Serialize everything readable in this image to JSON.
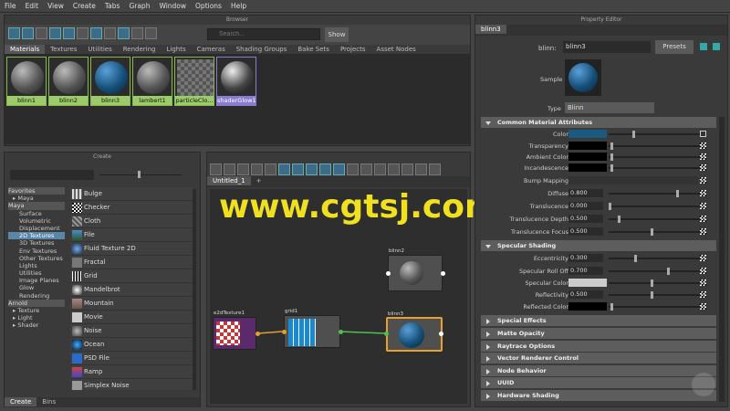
{
  "menu": [
    "File",
    "Edit",
    "View",
    "Create",
    "Tabs",
    "Graph",
    "Window",
    "Options",
    "Help"
  ],
  "browser": {
    "title": "Browser",
    "search_placeholder": "Search...",
    "show_label": "Show",
    "tabs": [
      "Materials",
      "Textures",
      "Utilities",
      "Rendering",
      "Lights",
      "Cameras",
      "Shading Groups",
      "Bake Sets",
      "Projects",
      "Asset Nodes"
    ],
    "swatches": [
      "blinn1",
      "blinn2",
      "blinn3",
      "lambert1",
      "particleClo...",
      "shaderGlow1"
    ]
  },
  "create": {
    "title": "Create",
    "tree": [
      "Favorites",
      "Maya",
      "Maya",
      "Surface",
      "Volumetric",
      "Displacement",
      "2D Textures",
      "3D Textures",
      "Env Textures",
      "Other Textures",
      "Lights",
      "Utilities",
      "Image Planes",
      "Glow",
      "Rendering",
      "Arnold",
      "Texture",
      "Light",
      "Shader"
    ],
    "items": [
      "Bulge",
      "Checker",
      "Cloth",
      "File",
      "Fluid Texture 2D",
      "Fractal",
      "Grid",
      "Mandelbrot",
      "Mountain",
      "Movie",
      "Noise",
      "Ocean",
      "PSD File",
      "Ramp",
      "Simplex Noise"
    ],
    "bottom_tabs": [
      "Create",
      "Bins"
    ]
  },
  "graph": {
    "tab": "Untitled_1",
    "add": "+",
    "nodes": [
      "blinn2",
      "e2dTexture1",
      "grid1",
      "blinn3"
    ]
  },
  "watermark": "www.cgtsj.com",
  "prop": {
    "title": "Property Editor",
    "tab": "blinn3",
    "name_label": "blinn:",
    "name_value": "blinn3",
    "presets": "Presets",
    "sample_label": "Sample",
    "type_label": "Type",
    "type_value": "Blinn",
    "sections": {
      "common": "Common Material Attributes",
      "specular": "Specular Shading"
    },
    "common_rows": [
      {
        "label": "Color",
        "value": ""
      },
      {
        "label": "Transparency",
        "value": ""
      },
      {
        "label": "Ambient Color",
        "value": ""
      },
      {
        "label": "Incandescence",
        "value": ""
      },
      {
        "label": "Bump Mapping",
        "value": ""
      },
      {
        "label": "Diffuse",
        "value": "0.800"
      },
      {
        "label": "Translucence",
        "value": "0.000"
      },
      {
        "label": "Translucence Depth",
        "value": "0.500"
      },
      {
        "label": "Translucence Focus",
        "value": "0.500"
      }
    ],
    "spec_rows": [
      {
        "label": "Eccentricity",
        "value": "0.300"
      },
      {
        "label": "Specular Roll Off",
        "value": "0.700"
      },
      {
        "label": "Specular Color",
        "value": ""
      },
      {
        "label": "Reflectivity",
        "value": "0.500"
      },
      {
        "label": "Reflected Color",
        "value": ""
      }
    ],
    "closed": [
      "Special Effects",
      "Matte Opacity",
      "Raytrace Options",
      "Vector Renderer Control",
      "Node Behavior",
      "UUID",
      "Hardware Shading"
    ]
  },
  "colors": {
    "accent": "#5a86a8",
    "swatch_label": "#9ccb6a",
    "watermark": "#f0e020"
  }
}
